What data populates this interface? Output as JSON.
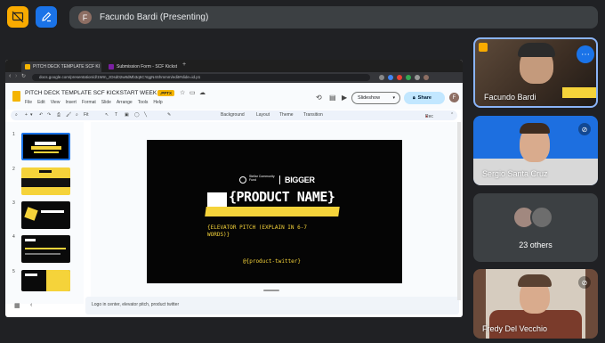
{
  "meet": {
    "presenter_initial": "F",
    "presenter_label": "Facundo Bardi (Presenting)"
  },
  "browser": {
    "tabs": [
      {
        "label": "PITCH DECK TEMPLATE SCF KI",
        "active": true
      },
      {
        "label": "Submission Form - SCF Kickst",
        "active": false
      }
    ],
    "url": "docs.google.com/presentation/d/1Wm_zDsd02w8dMb3q5CYqgN4Shmmm/edit#slide=id.p1"
  },
  "slides": {
    "doc_title": "PITCH DECK TEMPLATE SCF KICKSTART WEEK",
    "file_badge": ".PPTX",
    "menu": [
      "File",
      "Edit",
      "View",
      "Insert",
      "Format",
      "Slide",
      "Arrange",
      "Tools",
      "Help"
    ],
    "slideshow_label": "Slideshow",
    "share_label": "Share",
    "user_initial": "F",
    "toolbar": {
      "zoom": "Fit",
      "background": "Background",
      "layout": "Layout",
      "theme": "Theme",
      "transition": "Transition",
      "rec": "Rec"
    },
    "thumb_numbers": [
      "1",
      "2",
      "3",
      "4",
      "5"
    ],
    "notes_text": "Logo in center, elevator pitch, product twitter"
  },
  "slide_main": {
    "logo_left": "Stellar Community Fund",
    "logo_right": "BIGGER",
    "product_name": "{PRODUCT NAME}",
    "elevator_line1": "{ELEVATOR PITCH (EXPLAIN IN 6-7",
    "elevator_line2": "WORDS)}",
    "twitter": "@{product-twitter}"
  },
  "participants": {
    "facundo": "Facundo Bardi",
    "sergio": "Sergio Santa Cruz",
    "others": "23 others",
    "fredy": "Fredy Del Vecchio"
  },
  "colors": {
    "accent_yellow": "#f5d33a",
    "meet_bg": "#202124",
    "tile_blue": "#1a73e8"
  }
}
